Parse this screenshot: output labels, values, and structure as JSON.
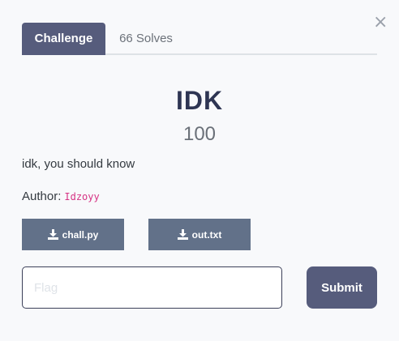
{
  "modal": {
    "close_glyph": "×",
    "close_icon": "close-icon"
  },
  "tabs": {
    "challenge_label": "Challenge",
    "solves_label": "66 Solves"
  },
  "challenge": {
    "name": "IDK",
    "points": "100",
    "description": "idk, you should know",
    "author_label": "Author:",
    "author_name": "Idzoyy"
  },
  "files": [
    {
      "label": "chall.py",
      "icon": "download-icon"
    },
    {
      "label": "out.txt",
      "icon": "download-icon"
    }
  ],
  "submission": {
    "flag_placeholder": "Flag",
    "flag_value": "",
    "submit_label": "Submit"
  },
  "colors": {
    "accent": "#565c7c",
    "file_button": "#627189",
    "title": "#2e3553",
    "author_name": "#d63384"
  }
}
